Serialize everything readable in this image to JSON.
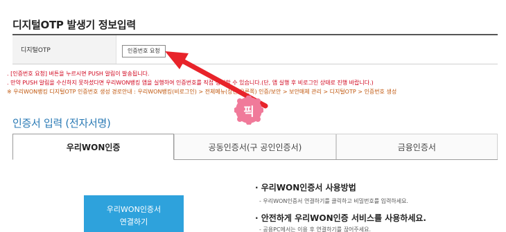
{
  "otp_section": {
    "title": "디지털OTP 발생기 정보입력",
    "label": "디지털OTP",
    "request_button": "인증번호 요청"
  },
  "notes": [
    ". [인증번호 요청] 버튼을 누르시면 PUSH 알림이 발송됩니다.",
    ". 만약 PUSH 알림을 수신하지 못하셨다면 우리WON뱅킹 앱을 실행하여 인증번호를 직접 생성할 수 있습니다.(단, 앱 실행 후 비로그인 상태로 진행 바랍니다.)",
    "※ 우리WON뱅킹 디지털OTP 인증번호 생성 경로안내 : 우리WON뱅킹(비로그인) > 전체메뉴(상단 오른쪽) 인증/보안 > 보안매체 관리 > 디지털OTP > 인증번호 생성"
  ],
  "cert_section": {
    "title": "인증서 입력 (전자서명)",
    "tabs": [
      {
        "label": "우리WON인증"
      },
      {
        "label": "공동인증서(구 공인인증서)"
      },
      {
        "label": "금융인증서"
      }
    ],
    "woori_button_line1": "우리WON인증서",
    "woori_button_line2": "연결하기",
    "howto_title": "· 우리WON인증서 사용방법",
    "howto_desc": "- 우리WON인증서 연결하기를 클릭하고 비밀번호를 입력하세요.",
    "safe_title": "· 안전하게 우리WON인증 서비스를 사용하세요.",
    "safe_desc": "- 공용PC에서는 이용 후 연결하기를 끊어주세요."
  },
  "annotation": {
    "badge_text": "픽",
    "arrow_color": "#e8232a",
    "badge_color": "#f07a9a"
  }
}
